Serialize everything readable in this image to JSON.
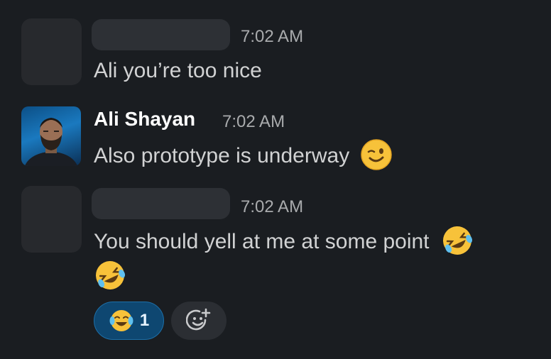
{
  "messages": [
    {
      "author": "",
      "time": "7:02 AM",
      "text": "Ali you’re too nice"
    },
    {
      "author": "Ali Shayan",
      "time": "7:02 AM",
      "text": "Also prototype is underway",
      "emoji": "winking-face-icon"
    },
    {
      "author": "",
      "time": "7:02 AM",
      "text_line1": "You should yell at me at some point",
      "emoji": "rolling-on-the-floor-laughing-icon",
      "reactions": [
        {
          "emoji": "face-with-tears-of-joy-icon",
          "count": "1"
        }
      ],
      "add_reaction_icon": "add-reaction-icon"
    }
  ],
  "colors": {
    "background": "#1a1d21",
    "text": "#d1d2d3",
    "timestamp": "#a9abad",
    "reaction_selected_bg": "#0e4771",
    "reaction_selected_border": "#1d6fa8"
  }
}
